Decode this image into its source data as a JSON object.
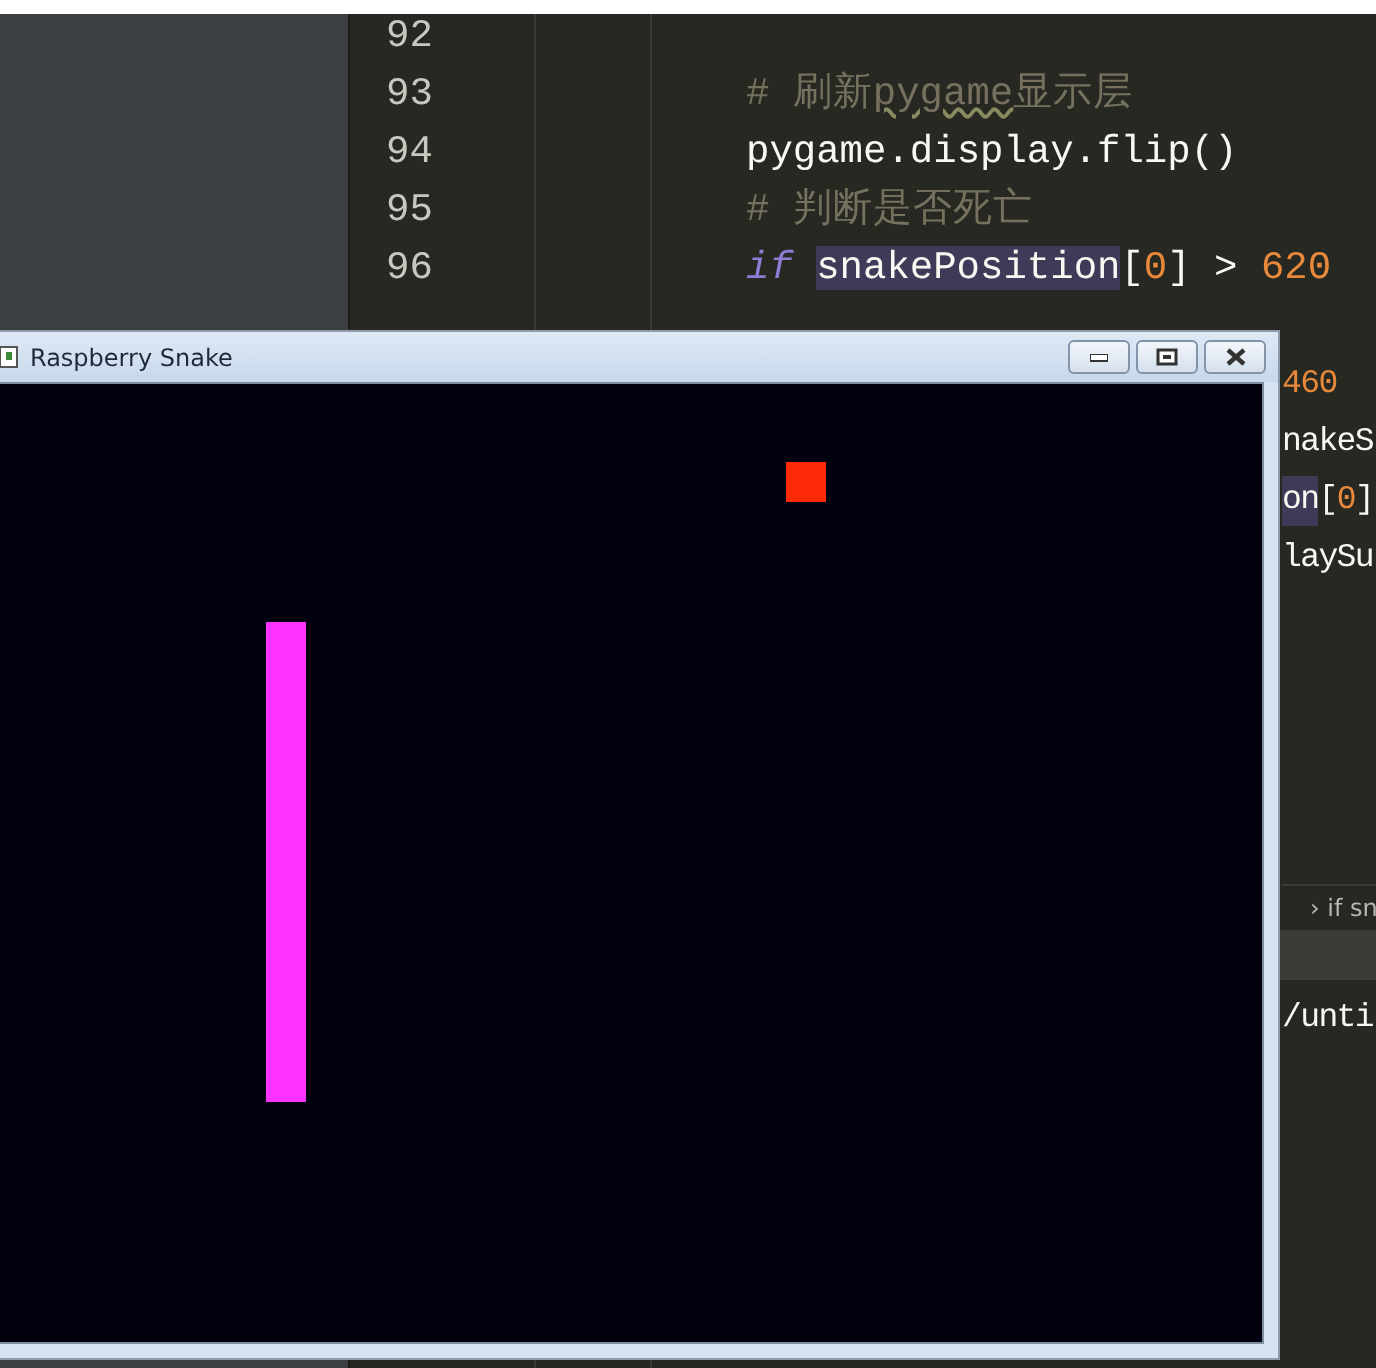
{
  "editor": {
    "lines": [
      {
        "number": "92"
      },
      {
        "number": "93",
        "tokens": [
          {
            "kind": "comment",
            "text": "# 刷新"
          },
          {
            "kind": "comment-typo",
            "text": "pygame"
          },
          {
            "kind": "comment",
            "text": "显示层"
          }
        ]
      },
      {
        "number": "94",
        "tokens": [
          {
            "kind": "plain",
            "text": "pygame.display.flip()"
          }
        ]
      },
      {
        "number": "95",
        "tokens": [
          {
            "kind": "comment",
            "text": "# 判断是否死亡"
          }
        ]
      },
      {
        "number": "96",
        "tokens": [
          {
            "kind": "keyword",
            "text": "if"
          },
          {
            "kind": "highlight",
            "text": "snakePosition"
          },
          {
            "kind": "plain",
            "text": "["
          },
          {
            "kind": "number",
            "text": "0"
          },
          {
            "kind": "plain",
            "text": "] > "
          },
          {
            "kind": "number",
            "text": "620"
          }
        ]
      }
    ],
    "fragments": [
      {
        "tokens": [
          {
            "kind": "number",
            "text": "460"
          }
        ]
      },
      {
        "tokens": [
          {
            "kind": "plain",
            "text": "nakeS"
          }
        ]
      },
      {
        "tokens": [
          {
            "kind": "highlight",
            "text": "on"
          },
          {
            "kind": "plain",
            "text": "["
          },
          {
            "kind": "number",
            "text": "0"
          },
          {
            "kind": "plain",
            "text": "]"
          }
        ]
      },
      {
        "tokens": [
          {
            "kind": "plain",
            "text": "laySu"
          }
        ]
      }
    ],
    "breadcrumb": "› if sn",
    "console_line": "/unti"
  },
  "window": {
    "title": "Raspberry Snake"
  }
}
